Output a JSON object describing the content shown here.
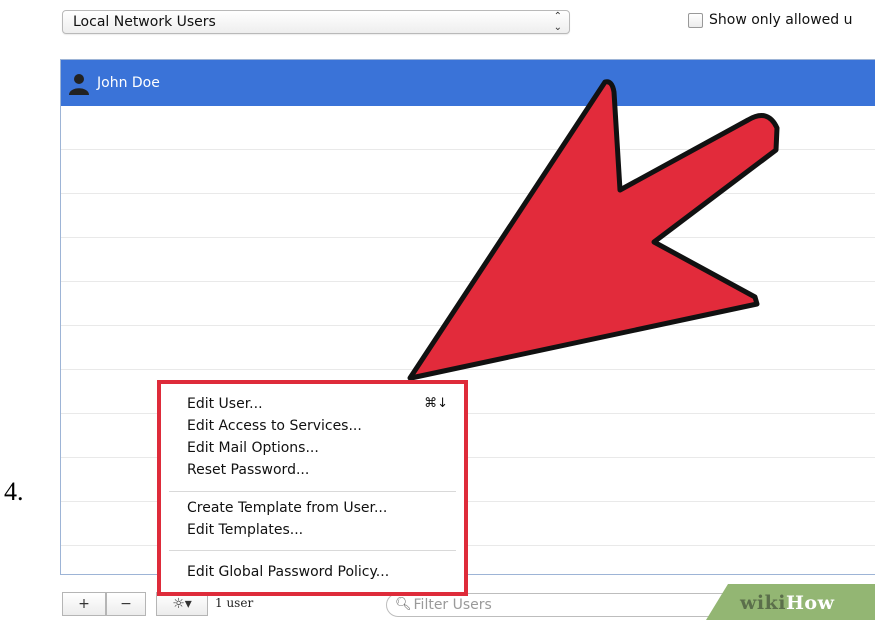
{
  "directory_popup": {
    "label": "Local Network Users",
    "arrows": "⌃⌄"
  },
  "show_only_allowed": {
    "label": "Show only allowed u",
    "checked": false
  },
  "users": [
    {
      "name": "John Doe",
      "selected": true
    }
  ],
  "context_menu": {
    "items": [
      {
        "label": "Edit User...",
        "shortcut": "⌘↓"
      },
      {
        "label": "Edit Access to Services..."
      },
      {
        "label": "Edit Mail Options..."
      },
      {
        "label": "Reset Password..."
      },
      {
        "label": "Create Template from User..."
      },
      {
        "label": "Edit Templates..."
      },
      {
        "label": "Edit Global Password Policy..."
      }
    ],
    "highlight_color": "#de2b3a"
  },
  "bottom_bar": {
    "add_label": "+",
    "remove_label": "−",
    "action_label": "☼▾",
    "user_count": "1 user",
    "filter_placeholder": "Filter Users"
  },
  "step_number": "4.",
  "watermark": {
    "wiki": "wiki",
    "how": "How"
  },
  "colors": {
    "selection": "#3a73d8",
    "arrow": "#e22b3b"
  }
}
